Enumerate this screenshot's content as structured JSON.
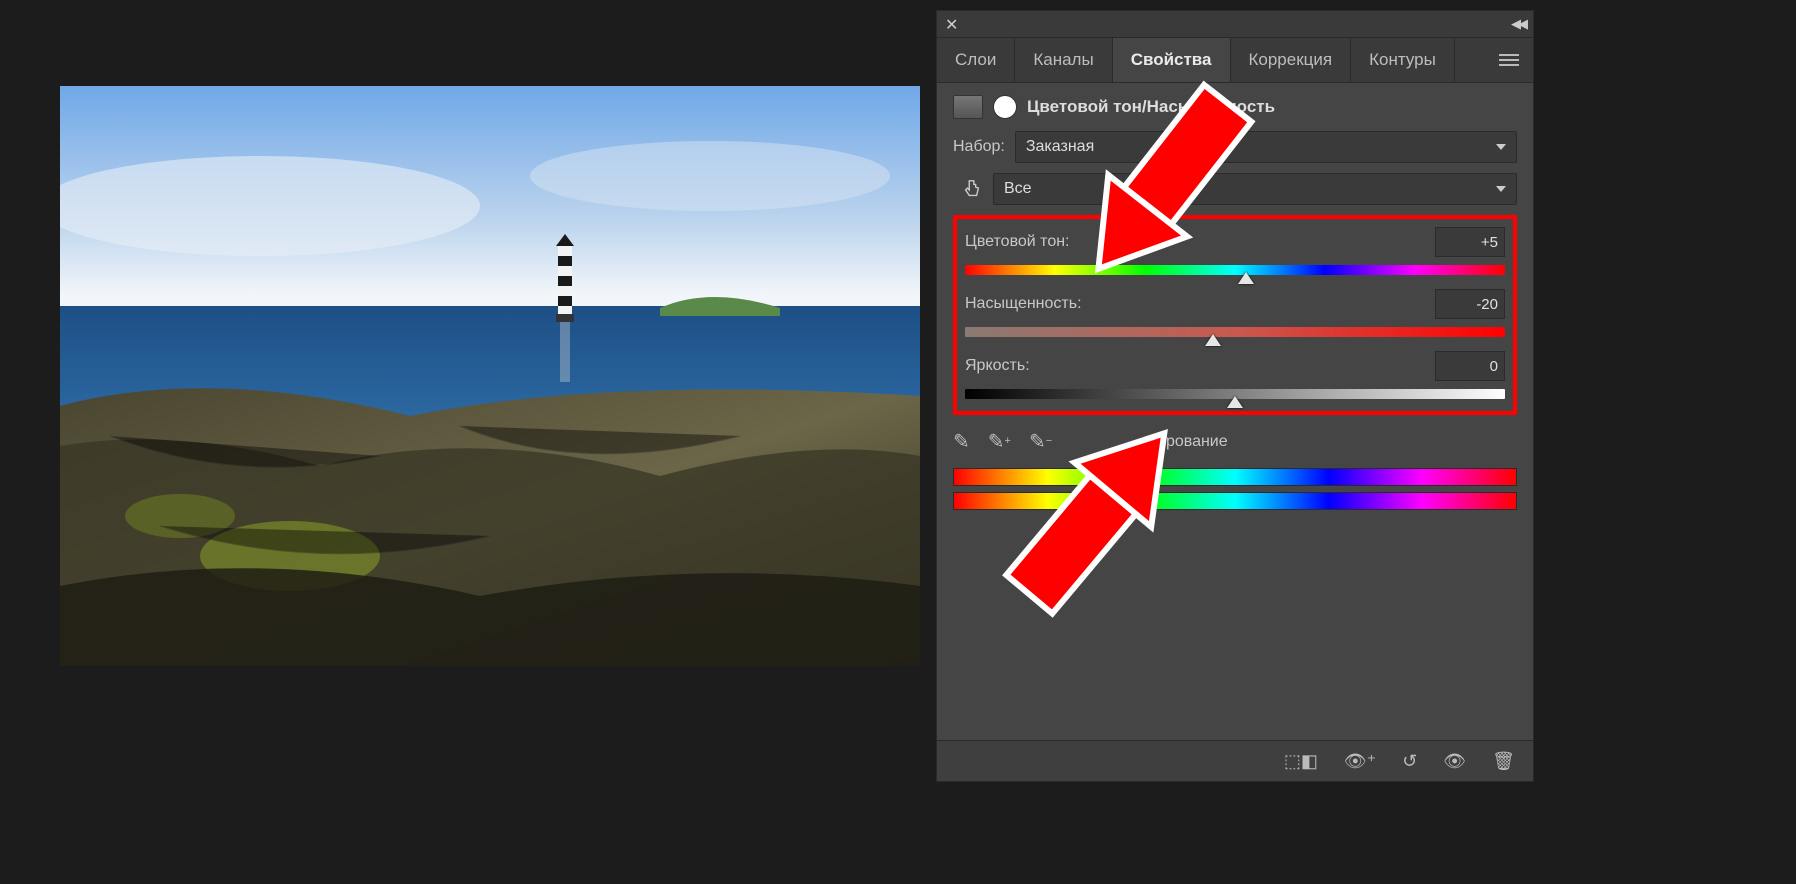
{
  "tabs": {
    "layers": "Слои",
    "channels": "Каналы",
    "properties": "Свойства",
    "adjustments": "Коррекция",
    "paths": "Контуры"
  },
  "header": {
    "title": "Цветовой тон/Насыщенность"
  },
  "preset": {
    "label": "Набор:",
    "value": "Заказная"
  },
  "range": {
    "value": "Все"
  },
  "sliders": {
    "hue": {
      "label": "Цветовой тон:",
      "value": "+5",
      "pos": 52
    },
    "sat": {
      "label": "Насыщенность:",
      "value": "-20",
      "pos": 46
    },
    "bri": {
      "label": "Яркость:",
      "value": "0",
      "pos": 50
    }
  },
  "colorize": {
    "label": "нирование"
  }
}
